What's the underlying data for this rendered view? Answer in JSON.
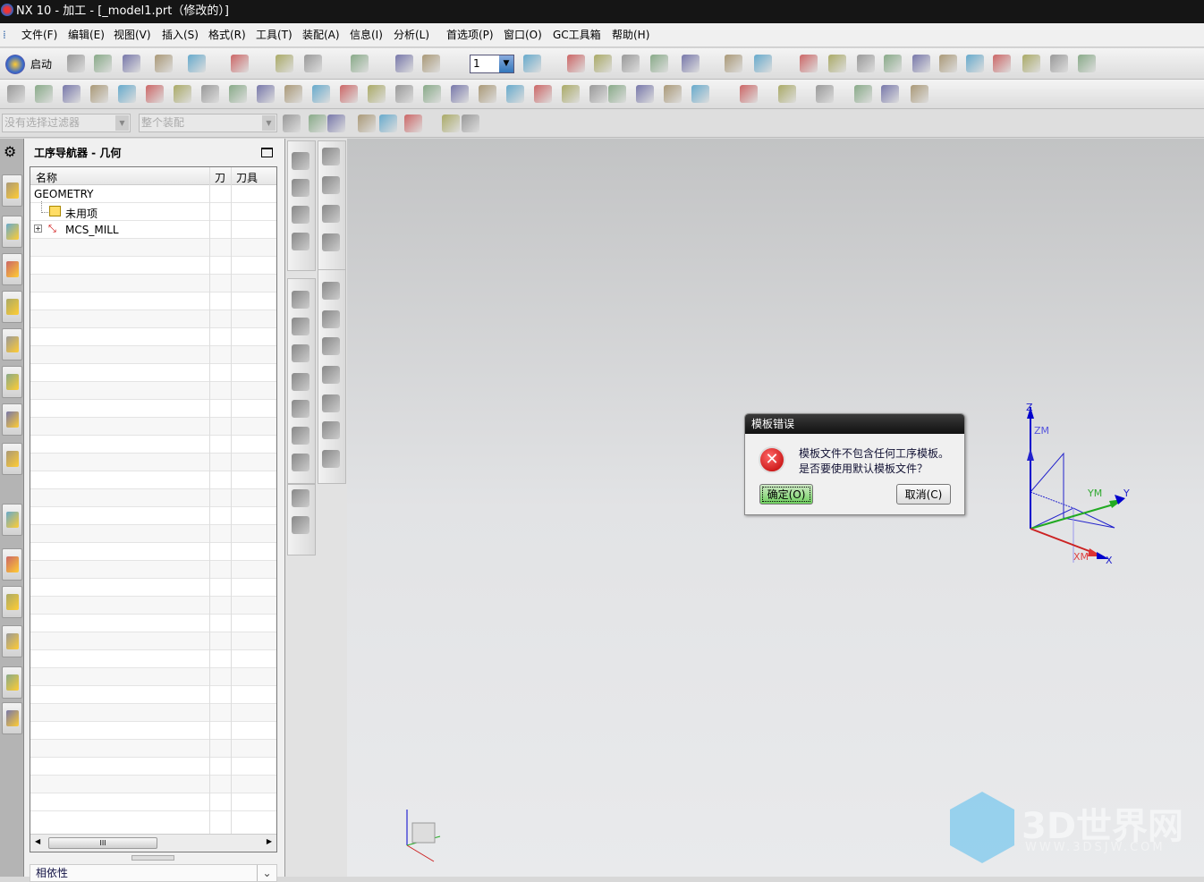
{
  "title": "NX 10 - 加工 - [_model1.prt（修改的）]",
  "menu": [
    "文件(F)",
    "编辑(E)",
    "视图(V)",
    "插入(S)",
    "格式(R)",
    "工具(T)",
    "装配(A)",
    "信息(I)",
    "分析(L)",
    "首选项(P)",
    "窗口(O)",
    "GC工具箱",
    "帮助(H)"
  ],
  "toolbar": {
    "start_label": "启动",
    "layer_value": "1",
    "filter_placeholder": "没有选择过滤器",
    "scope_placeholder": "整个装配"
  },
  "navigator": {
    "title": "工序导航器 - 几何",
    "columns": [
      "名称",
      "刀",
      "刀具"
    ],
    "rows": [
      "GEOMETRY",
      "未用项",
      "MCS_MILL"
    ],
    "dependency_label": "相依性",
    "scroll_grip": "III"
  },
  "dialog": {
    "title": "模板错误",
    "message_line1": "模板文件不包含任何工序模板。",
    "message_line2": "是否要使用默认模板文件？",
    "ok_label": "确定(O)",
    "cancel_label": "取消(C)",
    "error_icon": "✕"
  },
  "axes": {
    "z": "Z",
    "zm": "ZM",
    "y": "Y",
    "ym": "YM",
    "x": "X",
    "xm": "XM"
  },
  "watermark": {
    "text": "3D世界网",
    "url": "WWW.3DSJW.COM"
  }
}
